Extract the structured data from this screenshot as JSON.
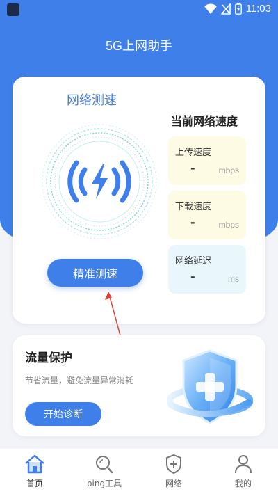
{
  "status_bar": {
    "time": "11:03"
  },
  "app": {
    "title": "5G上网助手"
  },
  "speed_test": {
    "heading": "网络测速",
    "button_label": "精准测速"
  },
  "current_speed": {
    "heading": "当前网络速度",
    "upload": {
      "label": "上传速度",
      "value": "-",
      "unit": "mbps"
    },
    "download": {
      "label": "下载速度",
      "value": "-",
      "unit": "mbps"
    },
    "latency": {
      "label": "网络延迟",
      "value": "-",
      "unit": "ms"
    }
  },
  "protection": {
    "title": "流量保护",
    "subtitle": "节省流量，避免流量异常消耗",
    "button_label": "开始诊断"
  },
  "bottom_nav": {
    "items": [
      {
        "label": "首页",
        "icon": "home-icon",
        "active": true
      },
      {
        "label": "ping工具",
        "icon": "ping-search-icon",
        "active": false
      },
      {
        "label": "网络",
        "icon": "shield-plus-icon",
        "active": false
      },
      {
        "label": "我的",
        "icon": "user-icon",
        "active": false
      }
    ]
  },
  "colors": {
    "primary": "#3f7fea",
    "upload_bg": "#fdfbe3",
    "download_bg": "#fdfbe3",
    "latency_bg": "#e9f7fd"
  }
}
